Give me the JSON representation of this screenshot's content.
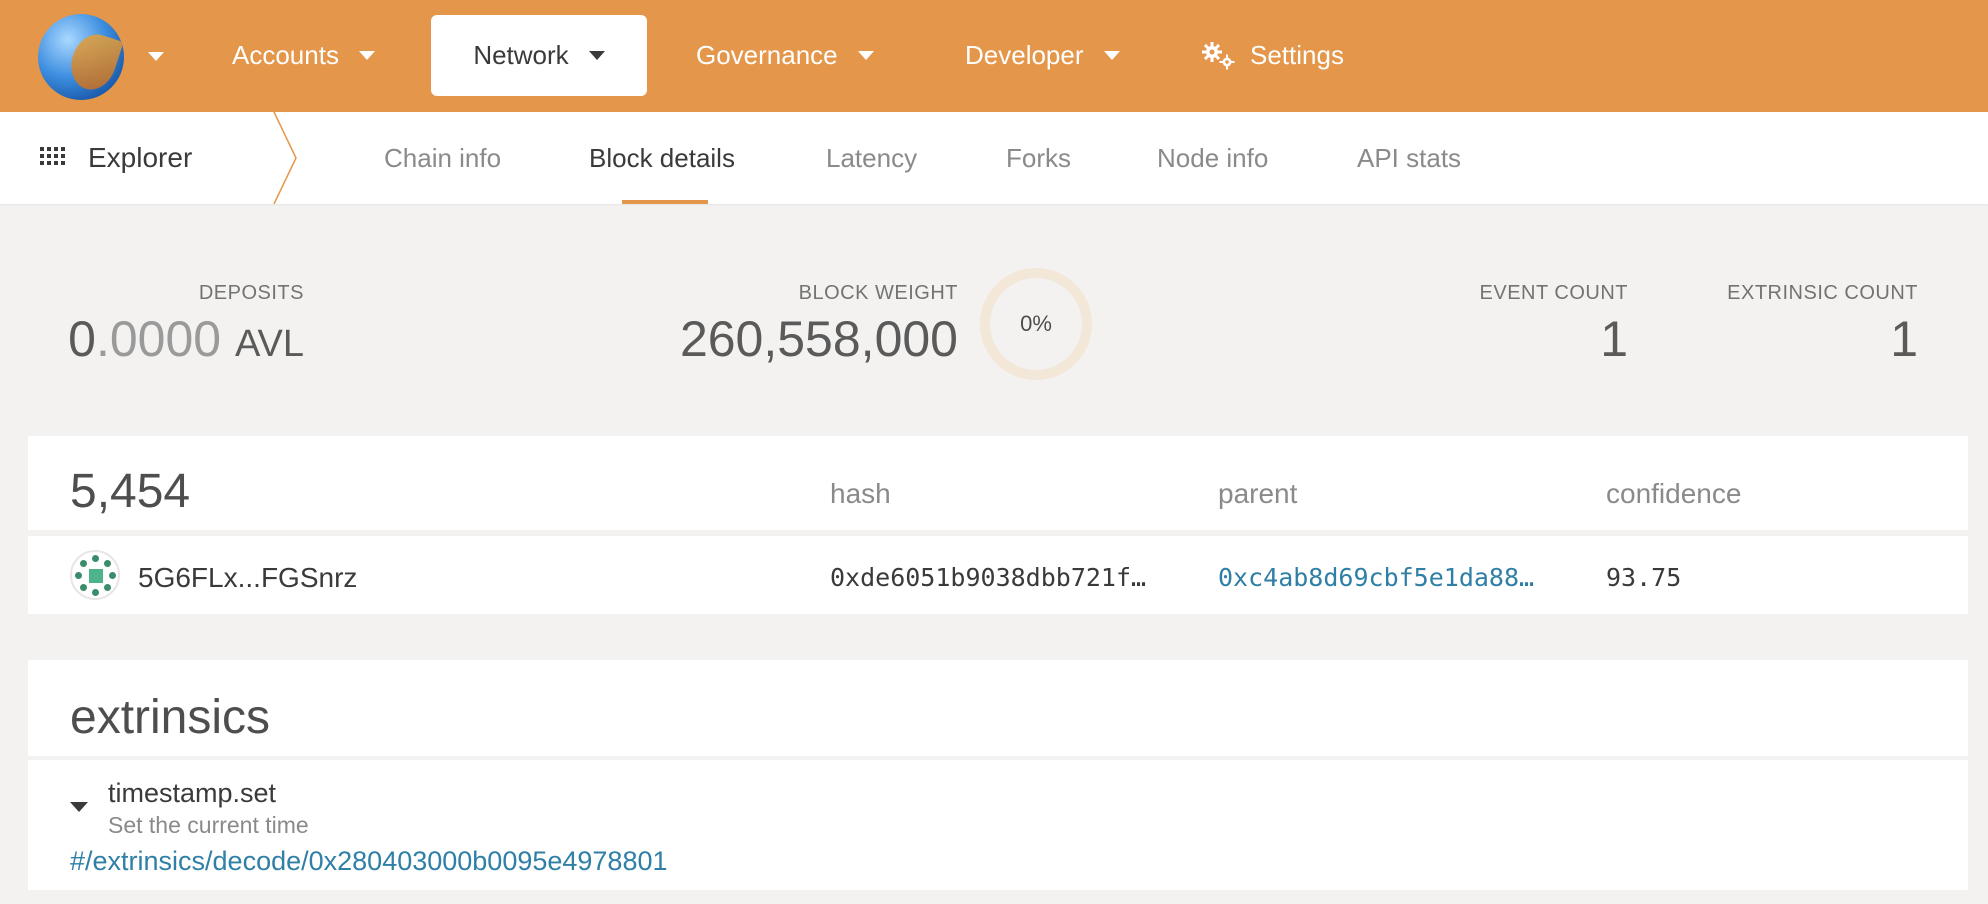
{
  "topnav": {
    "accounts": "Accounts",
    "network": "Network",
    "governance": "Governance",
    "developer": "Developer",
    "settings": "Settings"
  },
  "subnav": {
    "section": "Explorer",
    "tabs": [
      "Chain info",
      "Block details",
      "Latency",
      "Forks",
      "Node info",
      "API stats"
    ],
    "active_tab": "Block details"
  },
  "summary": {
    "deposits_label": "DEPOSITS",
    "deposits_int": "0",
    "deposits_frac": ".0000",
    "deposits_unit": "AVL",
    "block_weight_label": "BLOCK WEIGHT",
    "block_weight_value": "260,558,000",
    "block_weight_percent": "0%",
    "event_count_label": "EVENT COUNT",
    "event_count_value": "1",
    "extrinsic_count_label": "EXTRINSIC COUNT",
    "extrinsic_count_value": "1"
  },
  "block": {
    "number": "5,454",
    "columns": {
      "hash": "hash",
      "parent": "parent",
      "confidence": "confidence"
    },
    "author": "5G6FLx...FGSnrz",
    "hash": "0xde6051b9038dbb721f…",
    "parent": "0xc4ab8d69cbf5e1da88…",
    "confidence": "93.75"
  },
  "extrinsics": {
    "title": "extrinsics",
    "items": [
      {
        "method": "timestamp.set",
        "description": "Set the current time",
        "link": "#/extrinsics/decode/0x280403000b0095e4978801"
      }
    ]
  },
  "colors": {
    "accent": "#e4964a",
    "link": "#2f7fa6",
    "background": "#f3f2f1"
  }
}
